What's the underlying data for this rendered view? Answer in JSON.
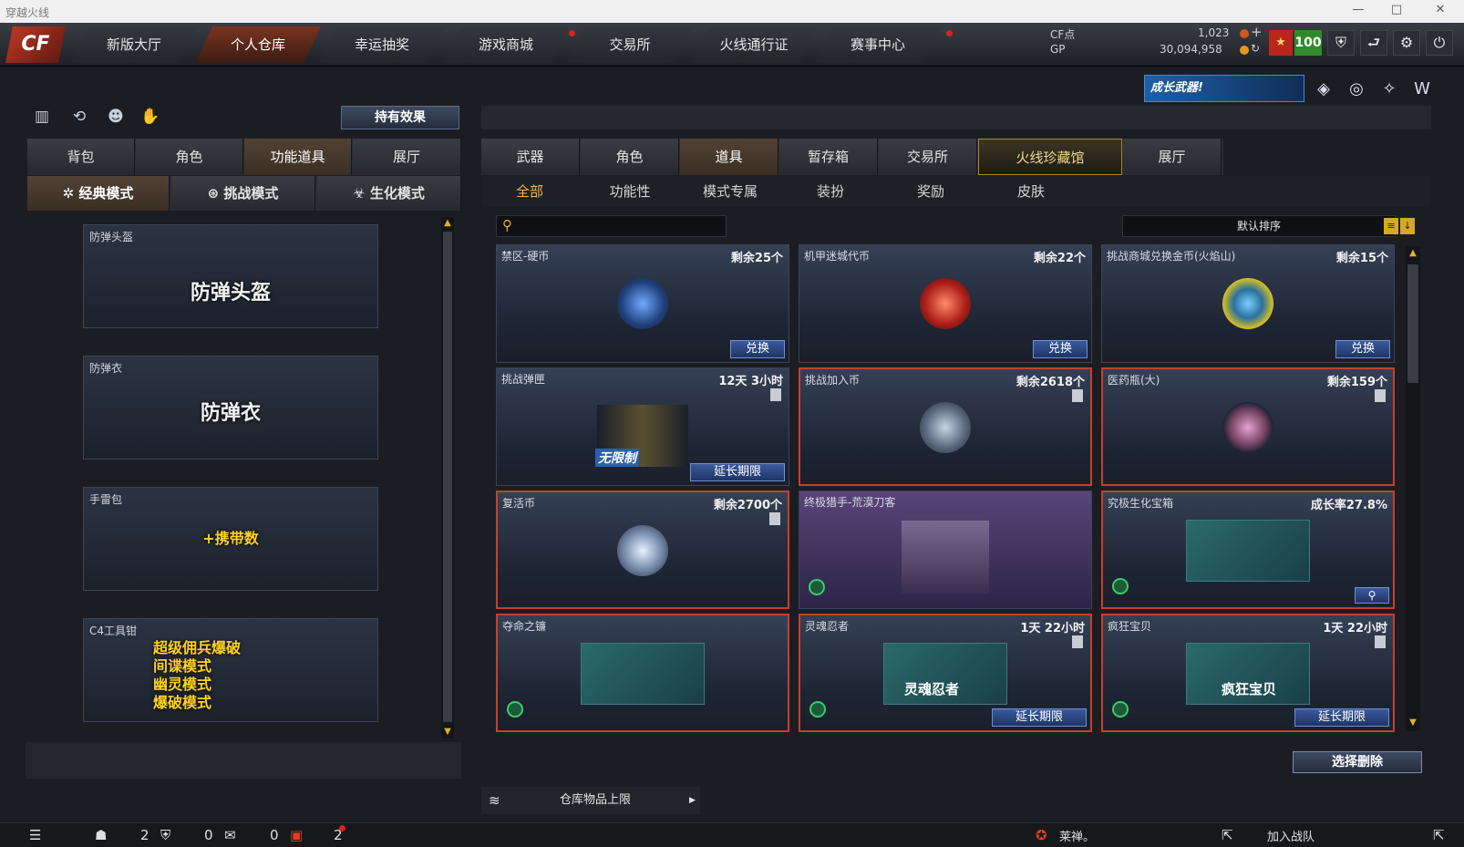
{
  "window": {
    "title": "穿越火线"
  },
  "nav": {
    "tabs": [
      "新版大厅",
      "个人仓库",
      "幸运抽奖",
      "游戏商城",
      "交易所",
      "火线通行证",
      "赛事中心"
    ],
    "active": 1
  },
  "currency": {
    "cf_label": "CF点",
    "cf_value": "1,023",
    "gp_label": "GP",
    "gp_value": "30,094,958",
    "level": "100"
  },
  "banner": {
    "text": "成长武器!"
  },
  "left": {
    "effects_button": "持有效果",
    "tabs": [
      "背包",
      "角色",
      "功能道具",
      "展厅"
    ],
    "active_tab": 2,
    "modes": [
      "经典模式",
      "挑战模式",
      "生化模式"
    ],
    "cards": [
      {
        "label": "防弹头盔",
        "content": "防弹头盔"
      },
      {
        "label": "防弹衣",
        "content": "防弹衣"
      },
      {
        "label": "手雷包",
        "content": "+携带数"
      },
      {
        "label": "C4工具钳",
        "content": "超级佣兵爆破\n间谍模式\n幽灵模式\n爆破模式"
      }
    ]
  },
  "right": {
    "tabs": [
      "武器",
      "角色",
      "道具",
      "暂存箱",
      "交易所",
      "火线珍藏馆",
      "展厅"
    ],
    "active_tab": 2,
    "gold_tab": 5,
    "subtabs": [
      "全部",
      "功能性",
      "模式专属",
      "装扮",
      "奖励",
      "皮肤"
    ],
    "active_subtab": 0,
    "sort_label": "默认排序",
    "items": [
      {
        "name": "禁区-硬币",
        "qty": "剩余25个",
        "btn": "兑换"
      },
      {
        "name": "机甲迷城代币",
        "qty": "剩余22个",
        "btn": "兑换"
      },
      {
        "name": "挑战商城兑换金币(火焰山)",
        "qty": "剩余15个",
        "btn": "兑换"
      },
      {
        "name": "挑战弹匣",
        "qty": "12天 3小时",
        "btn": "延长期限",
        "pic_text": "无限制"
      },
      {
        "name": "挑战加入币",
        "qty": "剩余2618个"
      },
      {
        "name": "医药瓶(大)",
        "qty": "剩余159个"
      },
      {
        "name": "复活币",
        "qty": "剩余2700个"
      },
      {
        "name": "终极猎手-荒漠刀客",
        "qty": ""
      },
      {
        "name": "究极生化宝箱",
        "qty": "成长率27.8%"
      },
      {
        "name": "夺命之镰",
        "qty": ""
      },
      {
        "name": "灵魂忍者",
        "qty": "1天 22小时",
        "btn": "延长期限",
        "pic_text": "灵魂忍者"
      },
      {
        "name": "疯狂宝贝",
        "qty": "1天 22小时",
        "btn": "延长期限",
        "pic_text": "疯狂宝贝"
      }
    ],
    "delete_button": "选择删除",
    "capacity_label": "仓库物品上限"
  },
  "status": {
    "count1": "2",
    "count2": "0",
    "count3": "0",
    "count4": "2",
    "chat": "莱禅。",
    "join": "加入战队"
  }
}
